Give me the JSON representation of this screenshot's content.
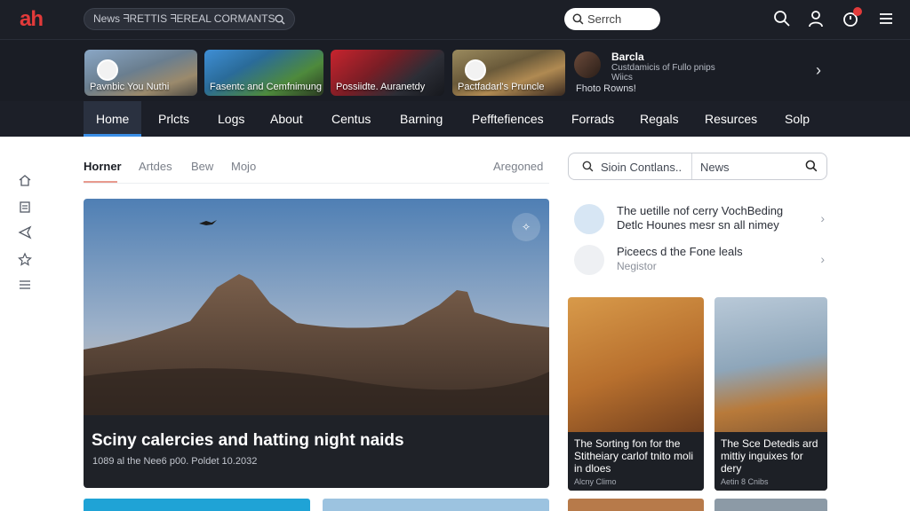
{
  "app": {
    "logo": "ah"
  },
  "header": {
    "news_box": "News ᖷRETTIS ᖷEREAL CORMANTS",
    "search_placeholder": "Serrch"
  },
  "stories": [
    {
      "label": "Pavnbic You Nuthi"
    },
    {
      "label": "Fasentc and Cemfnimung"
    },
    {
      "label": "Possiidte. Auranetdy"
    },
    {
      "label": "Pactfadarl's Pruncle"
    }
  ],
  "story_text": {
    "name": "Barcla",
    "desc": "Custdamicis of Fullo pnips Wiics",
    "footer": "Fhoto Rowns!"
  },
  "nav": {
    "items": [
      "Home",
      "Prlcts",
      "Logs",
      "About",
      "Centus",
      "Barning",
      "Pefftefiences",
      "Forrads",
      "Regals",
      "Resurces",
      "Solp"
    ]
  },
  "subtabs": [
    "Horner",
    "Artdes",
    "Bew",
    "Mojo"
  ],
  "subtab_right": "Aregoned",
  "hero": {
    "title": "Sciny calercies and hatting night naids",
    "meta": "1089 al the Nee6 p00. Poldet 10.2032"
  },
  "side_search": {
    "placeholder": "Sioin Contlans..",
    "category": "News"
  },
  "list": [
    {
      "title": "The uetille nof cerry VochBeding Detlc Hounes mesr sn all nimey",
      "sub": ""
    },
    {
      "title": "Piceecs d the Fone leals",
      "sub": "Negistor"
    }
  ],
  "cards": [
    {
      "title": "The Sorting fon for the Stitheiary carlof tnito moli in dloes",
      "meta": "Alcny Climo"
    },
    {
      "title": "The Sce Detedis ard mittiy inguixes for dery",
      "meta": "Aetin 8 Cnibs"
    }
  ],
  "colors": {
    "brand": "#e23a3a",
    "nav_bg": "#1c1f28",
    "active_underline": "#3a8ee6",
    "notification": "#e23a3a"
  }
}
